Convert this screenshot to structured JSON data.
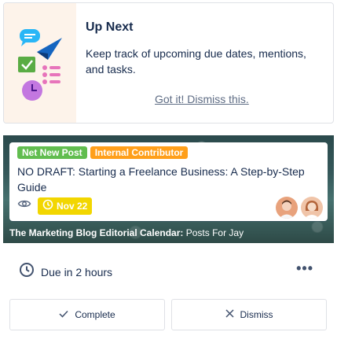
{
  "up_next": {
    "title": "Up Next",
    "description": "Keep track of upcoming due dates, mentions, and tasks.",
    "dismiss_link": "Got it! Dismiss this."
  },
  "card": {
    "labels": [
      {
        "text": "Net New Post",
        "color": "#61bd4f"
      },
      {
        "text": "Internal Contributor",
        "color": "#ff9f1a"
      }
    ],
    "title": "NO DRAFT: Starting a Freelance Business: A Step-by-Step Guide",
    "due_badge": "Nov 22",
    "due_badge_color": "#f2d600",
    "board_name": "The Marketing Blog Editorial Calendar:",
    "list_name": "Posts For Jay"
  },
  "due": {
    "text": "Due in 2 hours"
  },
  "actions": {
    "complete_label": "Complete",
    "dismiss_label": "Dismiss"
  },
  "icons": {
    "watch": "eye-icon",
    "due": "clock-icon",
    "complete": "check-icon",
    "dismiss": "close-icon",
    "more": "more-horizontal-icon"
  }
}
